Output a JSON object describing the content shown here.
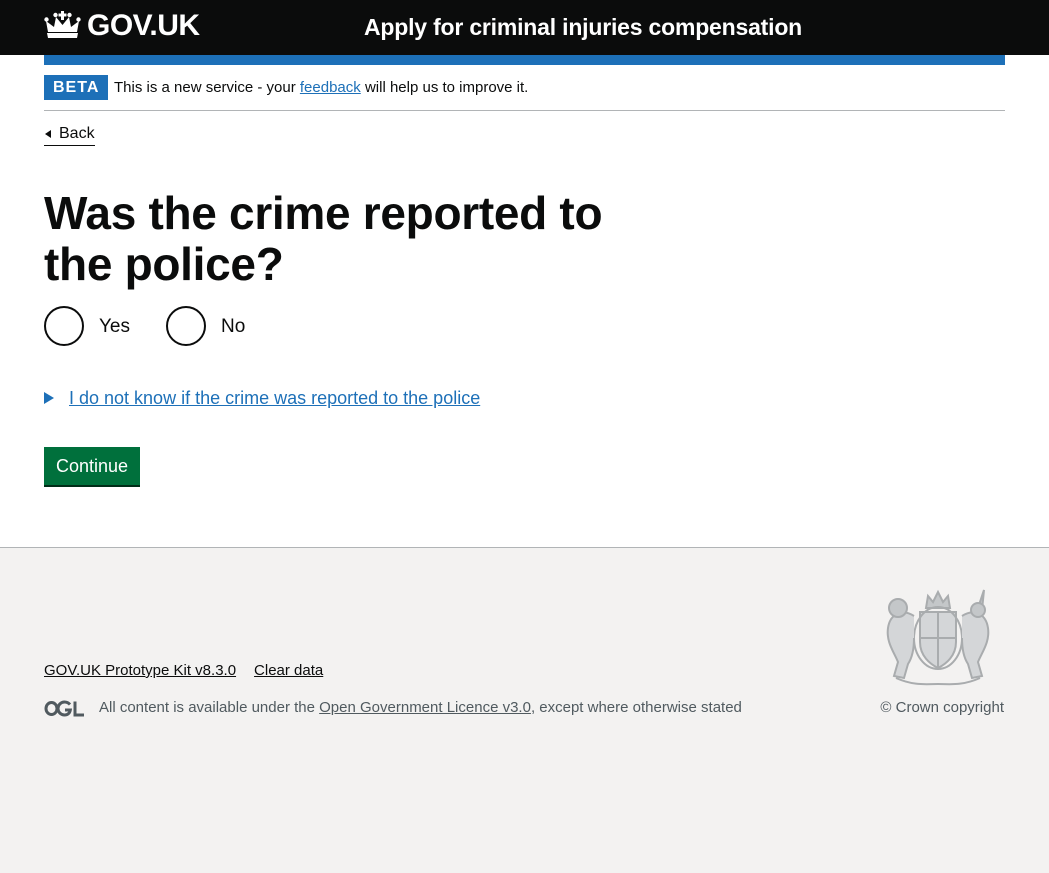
{
  "header": {
    "logo_text": "GOV.UK",
    "service_name": "Apply for criminal injuries compensation"
  },
  "phase_banner": {
    "tag": "BETA",
    "text_before": "This is a new service - your ",
    "link_text": "feedback",
    "text_after": " will help us to improve it."
  },
  "back_link": "Back",
  "question": {
    "heading": "Was the crime reported to the police?",
    "options": [
      {
        "label": "Yes",
        "checked": false
      },
      {
        "label": "No",
        "checked": false
      }
    ],
    "details_summary": "I do not know if the crime was reported to the police"
  },
  "continue_button": "Continue",
  "footer": {
    "links": [
      "GOV.UK Prototype Kit v8.3.0",
      "Clear data"
    ],
    "licence_before": "All content is available under the ",
    "licence_link": "Open Government Licence v3.0",
    "licence_after": ", except where otherwise stated",
    "copyright": "© Crown copyright"
  },
  "colors": {
    "header_bg": "#0b0c0c",
    "brand_blue": "#1d70b8",
    "button_green": "#00703c",
    "footer_bg": "#f3f2f1"
  }
}
